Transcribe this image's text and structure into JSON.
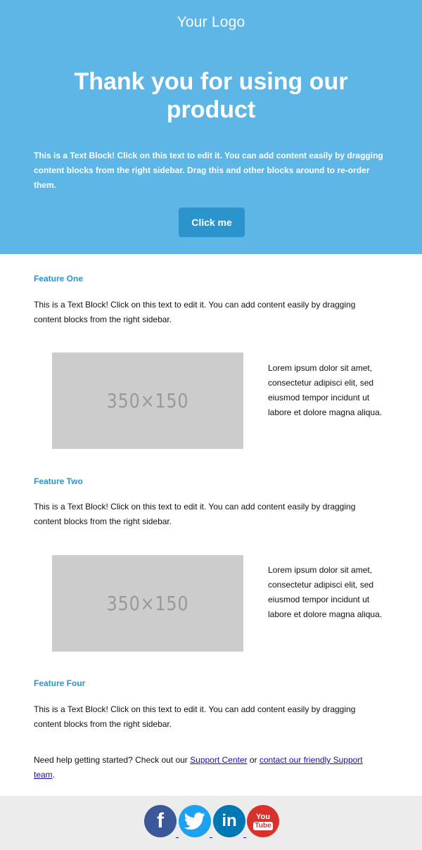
{
  "header": {
    "logo": "Your Logo",
    "title": "Thank you for using our product",
    "text": "This is a Text Block! Click on this text to edit it. You can add content easily by dragging content blocks from the right sidebar. Drag this and other blocks around to re-order them.",
    "button_label": "Click me"
  },
  "features": [
    {
      "title": "Feature One",
      "text": "This is a Text Block! Click on this text to edit it. You can add content easily by dragging content blocks from the right sidebar.",
      "image_label": "350×150",
      "side_text": "Lorem ipsum dolor sit amet, consectetur adipisci elit, sed eiusmod tempor incidunt ut labore et dolore magna aliqua."
    },
    {
      "title": "Feature Two",
      "text": "This is a Text Block! Click on this text to edit it. You can add content easily by dragging content blocks from the right sidebar.",
      "image_label": "350×150",
      "side_text": "Lorem ipsum dolor sit amet, consectetur adipisci elit, sed eiusmod tempor incidunt ut labore et dolore magna aliqua."
    },
    {
      "title": "Feature Four",
      "text": "This is a Text Block! Click on this text to edit it. You can add content easily by dragging content blocks from the right sidebar."
    }
  ],
  "help": {
    "prefix": "Need help getting started? Check out our ",
    "link1": "Support Center",
    "middle": " or ",
    "link2": "contact our friendly Support team",
    "suffix": "."
  },
  "social": {
    "facebook": "f",
    "linkedin": "in",
    "youtube_top": "You",
    "youtube_bottom": "Tube"
  },
  "colors": {
    "header_bg": "#5db6e6",
    "button_bg": "#2c94cc",
    "feature_title": "#2c94cc",
    "placeholder_bg": "#cccccc",
    "footer_bg": "#ececec",
    "facebook": "#3b5998",
    "twitter": "#1da1f2",
    "linkedin": "#0077b5",
    "youtube": "#d9322d"
  }
}
